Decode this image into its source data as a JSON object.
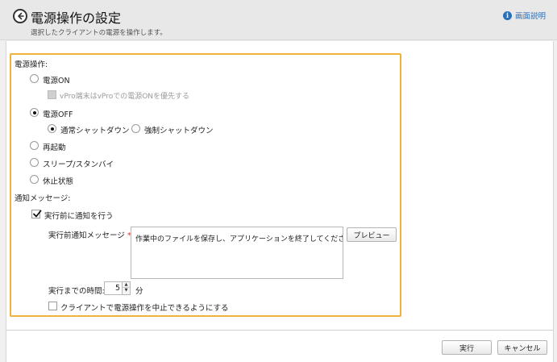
{
  "header": {
    "title": "電源操作の設定",
    "subtitle": "選択したクライアントの電源を操作します。",
    "help_label": "画面説明",
    "help_icon": "info-icon",
    "back_icon": "back-arrow-icon"
  },
  "power": {
    "section_label": "電源操作:",
    "options": [
      {
        "label": "電源ON",
        "selected": false
      },
      {
        "label": "電源OFF",
        "selected": true
      },
      {
        "label": "再起動",
        "selected": false
      },
      {
        "label": "スリープ/スタンバイ",
        "selected": false
      },
      {
        "label": "休止状態",
        "selected": false
      }
    ],
    "vpro_label": "vPro端末はvProでの電源ONを優先する",
    "vpro_checked": false,
    "vpro_enabled": false,
    "shutdown": {
      "normal_label": "通常シャットダウン",
      "normal_selected": true,
      "force_label": "強制シャットダウン",
      "force_selected": false
    }
  },
  "notify": {
    "section_label": "通知メッセージ:",
    "notify_before_label": "実行前に通知を行う",
    "notify_before_checked": true,
    "message_label": "実行前通知メッセージ",
    "required_mark": "*:",
    "message_value": "作業中のファイルを保存し、アプリケーションを終了してください。",
    "preview_label": "プレビュー",
    "time_label": "実行までの時間:",
    "time_value": "5",
    "time_unit": "分",
    "allow_cancel_label": "クライアントで電源操作を中止できるようにする",
    "allow_cancel_checked": false
  },
  "footer": {
    "execute_label": "実行",
    "cancel_label": "キャンセル"
  },
  "colors": {
    "panel_border": "#f0b23a",
    "link": "#2a6fb8",
    "required": "#d9342b"
  }
}
